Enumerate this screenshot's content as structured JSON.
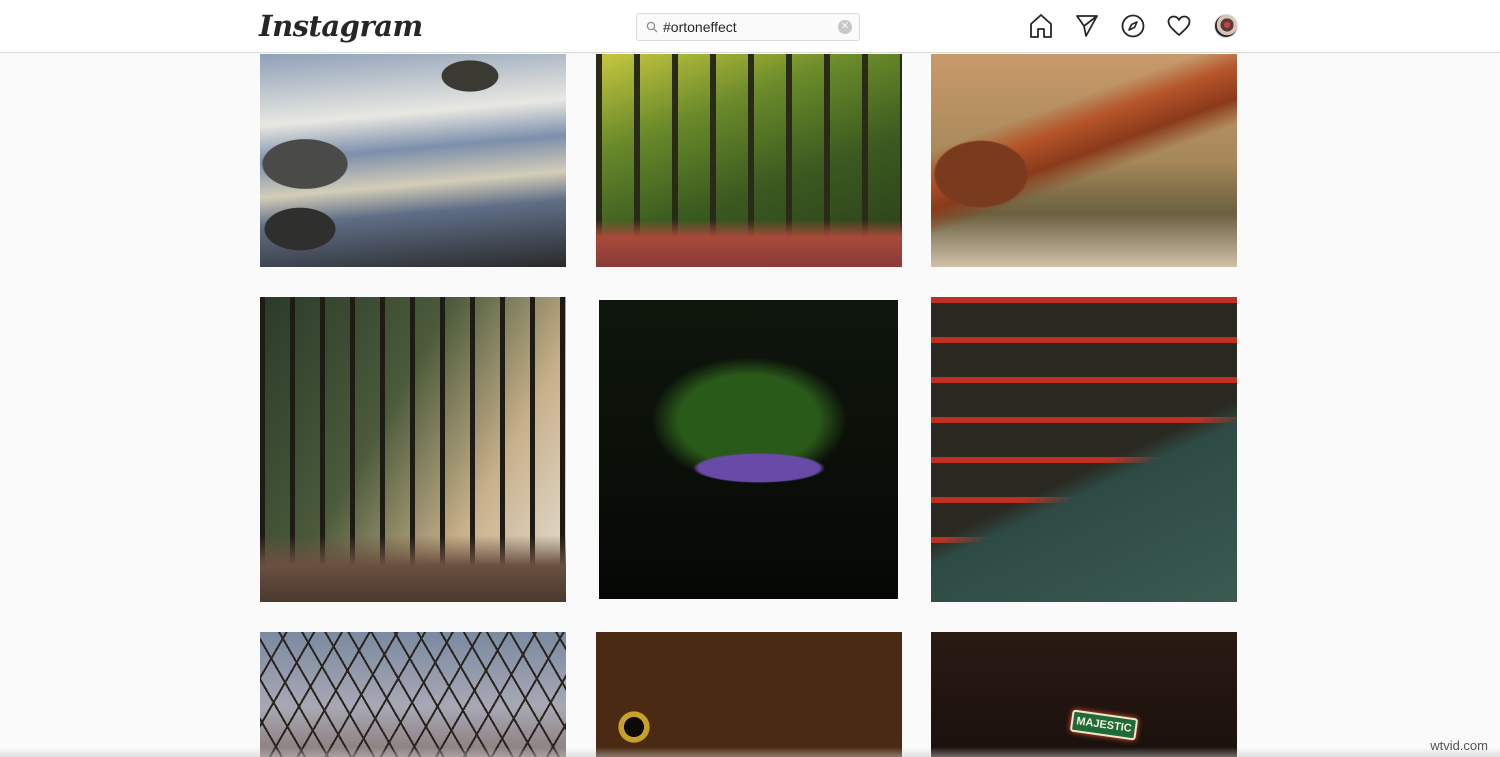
{
  "app": {
    "logo_text": "Instagram"
  },
  "search": {
    "value": "#ortoneffect",
    "clear_icon": "clear-icon",
    "search_icon": "search-icon"
  },
  "nav": {
    "icons": [
      "home-icon",
      "direct-message-icon",
      "explore-icon",
      "activity-heart-icon",
      "profile-avatar"
    ]
  },
  "grid": {
    "posts": [
      {
        "subject": "river-rocks"
      },
      {
        "subject": "forest-path-autumn"
      },
      {
        "subject": "snake-closeup"
      },
      {
        "subject": "forest-trail"
      },
      {
        "subject": "bluebells-dark-forest"
      },
      {
        "subject": "half-timbered-houses-canal"
      },
      {
        "subject": "bare-branches-sky"
      },
      {
        "subject": "toad-eyes-closeup"
      },
      {
        "subject": "theater-marquee-night"
      }
    ],
    "tile9_sign_text": "MAJESTIC"
  },
  "watermark": "wtvid.com"
}
